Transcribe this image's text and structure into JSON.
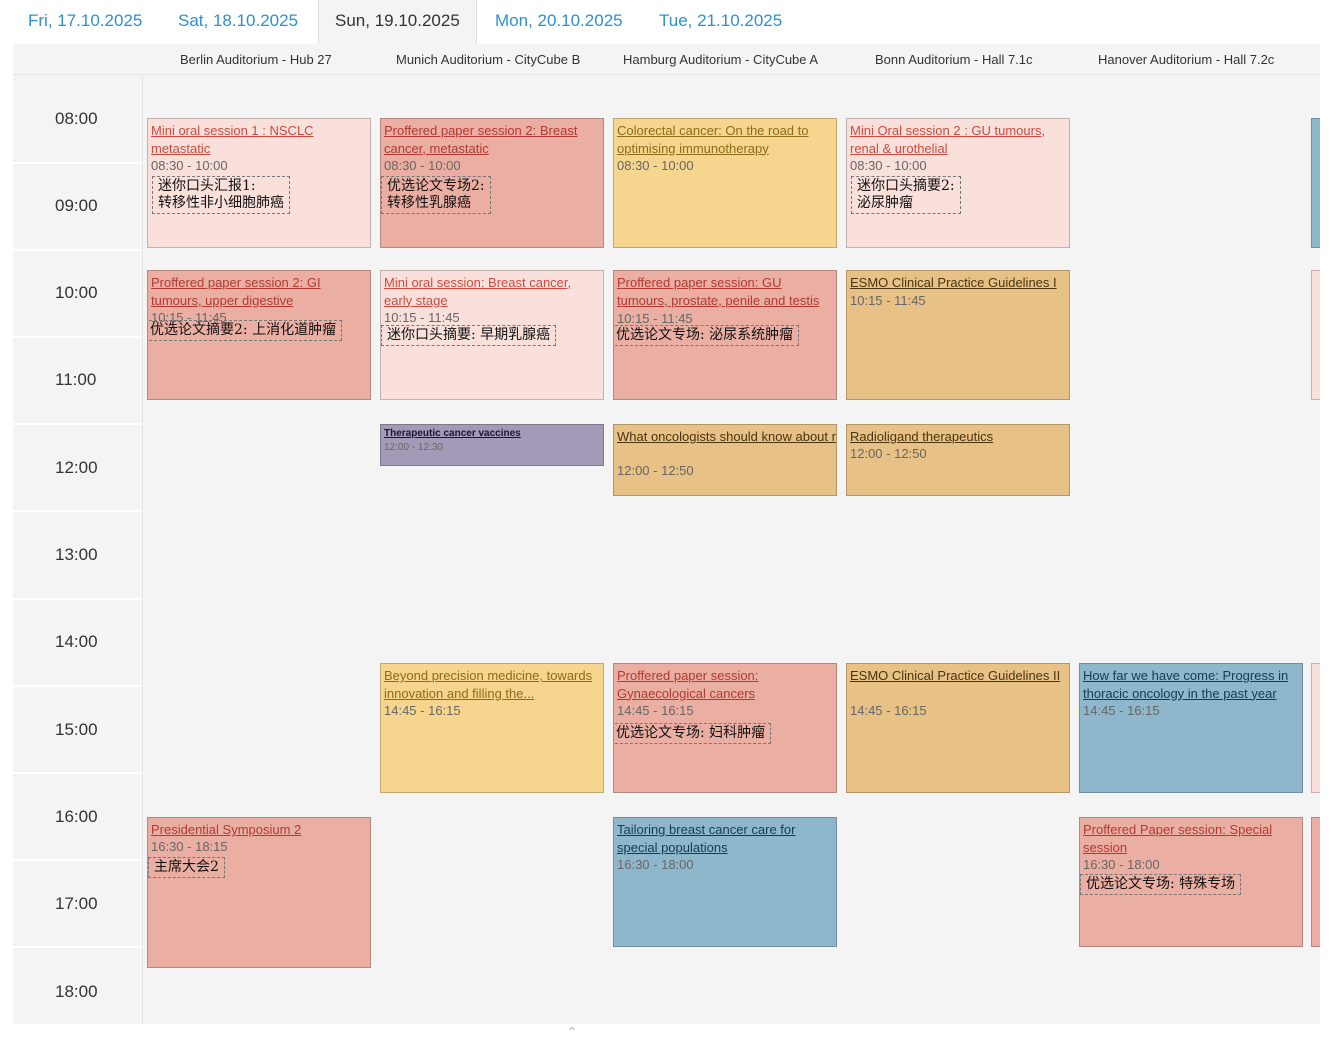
{
  "tabs": [
    "Fri, 17.10.2025",
    "Sat, 18.10.2025",
    "Sun, 19.10.2025",
    "Mon, 20.10.2025",
    "Tue, 21.10.2025"
  ],
  "active_tab": "Sun, 19.10.2025",
  "rooms": [
    "Berlin Auditorium - Hub 27",
    "Munich Auditorium - CityCube B",
    "Hamburg Auditorium - CityCube A",
    "Bonn Auditorium - Hall 7.1c",
    "Hanover Auditorium - Hall 7.2c"
  ],
  "times": [
    "08:00",
    "09:00",
    "10:00",
    "11:00",
    "12:00",
    "13:00",
    "14:00",
    "15:00",
    "16:00",
    "17:00",
    "18:00"
  ],
  "events": [
    {
      "title": "Mini oral session 1 : NSCLC metastatic",
      "time": "08:30 - 10:00",
      "note": "迷你口头汇报1:\n转移性非小细胞肺癌",
      "color": "pink"
    },
    {
      "title": "Proffered paper session 2: Breast cancer, metastatic",
      "time": "08:30 - 10:00",
      "note": "优选论文专场2:\n转移性乳腺癌",
      "color": "salmon"
    },
    {
      "title": "Colorectal cancer: On the road to optimising immunotherapy",
      "time": "08:30 - 10:00",
      "color": "yellow"
    },
    {
      "title": "Mini Oral session 2 : GU tumours, renal & urothelial",
      "time": "08:30 - 10:00",
      "note": "迷你口头摘要2:\n泌尿肿瘤",
      "color": "pink"
    },
    {
      "title": "Proffered paper session 2: GI tumours, upper digestive",
      "time": "10:15 - 11:45",
      "note": "优选论文摘要2: 上消化道肿瘤",
      "color": "salmon"
    },
    {
      "title": "Mini oral session: Breast cancer, early stage",
      "time": "10:15 - 11:45",
      "note": "迷你口头摘要: 早期乳腺癌",
      "color": "pink"
    },
    {
      "title": "Proffered paper session: GU tumours, prostate, penile and testis",
      "time": "10:15 - 11:45",
      "note": "优选论文专场: 泌尿系统肿瘤",
      "color": "salmon"
    },
    {
      "title": "ESMO Clinical Practice Guidelines I",
      "time": "10:15 - 11:45",
      "color": "orange"
    },
    {
      "title": "Therapeutic cancer vaccines",
      "time": "12:00 - 12:30",
      "color": "purple"
    },
    {
      "title": "What oncologists should know about molecular mechanisms of...",
      "time": "12:00 - 12:50",
      "color": "orange"
    },
    {
      "title": "Radioligand therapeutics",
      "time": "12:00 - 12:50",
      "color": "orange"
    },
    {
      "title": "Beyond precision medicine, towards innovation and filling the...",
      "time": "14:45 - 16:15",
      "color": "yellow"
    },
    {
      "title": "Proffered paper session: Gynaecological cancers",
      "time": "14:45 - 16:15",
      "note": "优选论文专场: 妇科肿瘤",
      "color": "salmon"
    },
    {
      "title": "ESMO Clinical Practice Guidelines II",
      "time": "14:45 - 16:15",
      "color": "orange"
    },
    {
      "title": "How far we have come: Progress in thoracic oncology in the past year",
      "time": "14:45 - 16:15",
      "color": "blue"
    },
    {
      "title": "Presidential Symposium 2",
      "time": "16:30 - 18:15",
      "note": "主席大会2",
      "color": "salmon"
    },
    {
      "title": "Tailoring breast cancer care for special populations",
      "time": "16:30 - 18:00",
      "color": "blue"
    },
    {
      "title": "Proffered Paper session: Special session",
      "time": "16:30 - 18:00",
      "note": "优选论文专场: 特殊专场",
      "color": "salmon"
    }
  ]
}
